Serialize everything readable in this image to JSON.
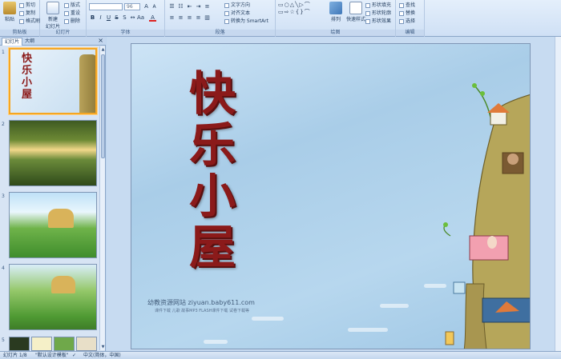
{
  "ribbon": {
    "clipboard": {
      "paste": "粘贴",
      "cut": "剪切",
      "copy": "复制",
      "format_painter": "格式刷",
      "label": "剪贴板"
    },
    "slides": {
      "new_slide": "新建\n幻灯片",
      "layout": "版式",
      "reset": "重设",
      "delete": "删除",
      "label": "幻灯片"
    },
    "font": {
      "size": "96",
      "label": "字体"
    },
    "paragraph": {
      "text_direction": "文字方向",
      "align_text": "对齐文本",
      "smartart": "转换为 SmartArt",
      "label": "段落"
    },
    "drawing": {
      "arrange": "排列",
      "quick_styles": "快速样式",
      "shape_fill": "形状填充",
      "shape_outline": "形状轮廓",
      "shape_effects": "形状效果",
      "label": "绘图"
    },
    "editing": {
      "find": "查找",
      "replace": "替换",
      "select": "选择",
      "label": "编辑"
    }
  },
  "left_pane": {
    "tab_slides": "幻灯片",
    "tab_outline": "大纲",
    "close": "×",
    "slides": [
      {
        "num": "1",
        "title": "快乐小屋"
      },
      {
        "num": "2"
      },
      {
        "num": "3"
      },
      {
        "num": "4"
      },
      {
        "num": "5"
      }
    ]
  },
  "slide": {
    "title": "快乐小屋",
    "site": "幼教资源网站  ziyuan.baby611.com",
    "site_sub": "课件下载  儿歌  故事MP3  FLASH课件下载  试卷下载等"
  },
  "status": {
    "slide_count": "幻灯片 1/8",
    "theme": "\"默认设计模板\"",
    "language": "中文(简体，中国)"
  },
  "colors": {
    "title": "#8b1a1a",
    "selection": "#f5a623"
  }
}
